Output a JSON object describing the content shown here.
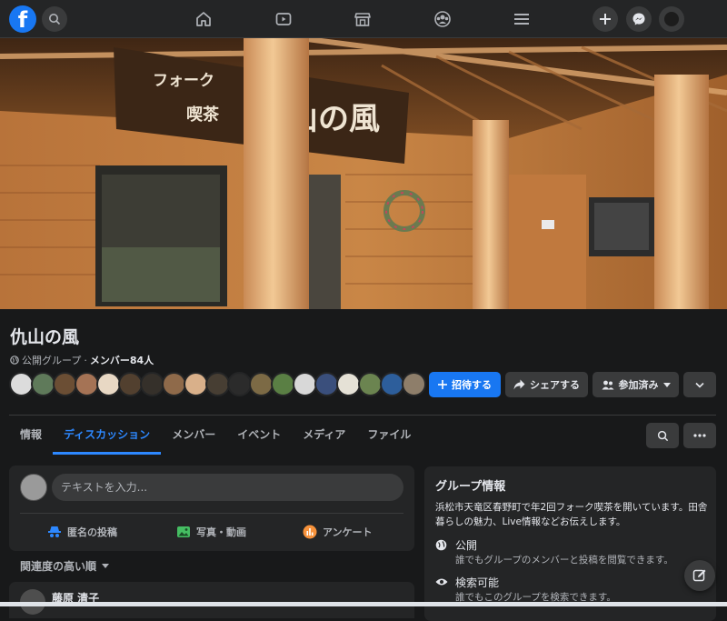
{
  "nav": {
    "logo": "f",
    "icons": [
      "search-icon",
      "home-icon",
      "watch-icon",
      "marketplace-icon",
      "groups-icon",
      "menu-icon",
      "plus-icon",
      "messenger-icon",
      "account-icon"
    ]
  },
  "cover": {
    "sign_line1": "フォーク",
    "sign_line2": "喫茶",
    "sign_name": "仇山の風"
  },
  "group": {
    "name": "仇山の風",
    "privacy": "公開グループ",
    "separator": "·",
    "members": "メンバー84人"
  },
  "actions": {
    "invite": "招待する",
    "share": "シェアする",
    "joined": "参加済み"
  },
  "tabs": [
    {
      "label": "情報"
    },
    {
      "label": "ディスカッション"
    },
    {
      "label": "メンバー"
    },
    {
      "label": "イベント"
    },
    {
      "label": "メディア"
    },
    {
      "label": "ファイル"
    }
  ],
  "composer": {
    "placeholder": "テキストを入力...",
    "anon_post": "匿名の投稿",
    "photo_video": "写真・動画",
    "poll": "アンケート"
  },
  "feed": {
    "sort_label": "関連度の高い順",
    "first_author": "藤原 清子"
  },
  "info": {
    "title": "グループ情報",
    "description": "浜松市天竜区春野町で年2回フォーク喫茶を開いています。田舎暮らしの魅力、Live情報などお伝えします。",
    "public_title": "公開",
    "public_desc": "誰でもグループのメンバーと投稿を閲覧できます。",
    "search_title": "検索可能",
    "search_desc": "誰でもこのグループを検索できます。"
  },
  "colors": {
    "accent": "#1877f2",
    "tab_active": "#2d88ff",
    "bg": "#18191a",
    "card": "#242526"
  }
}
